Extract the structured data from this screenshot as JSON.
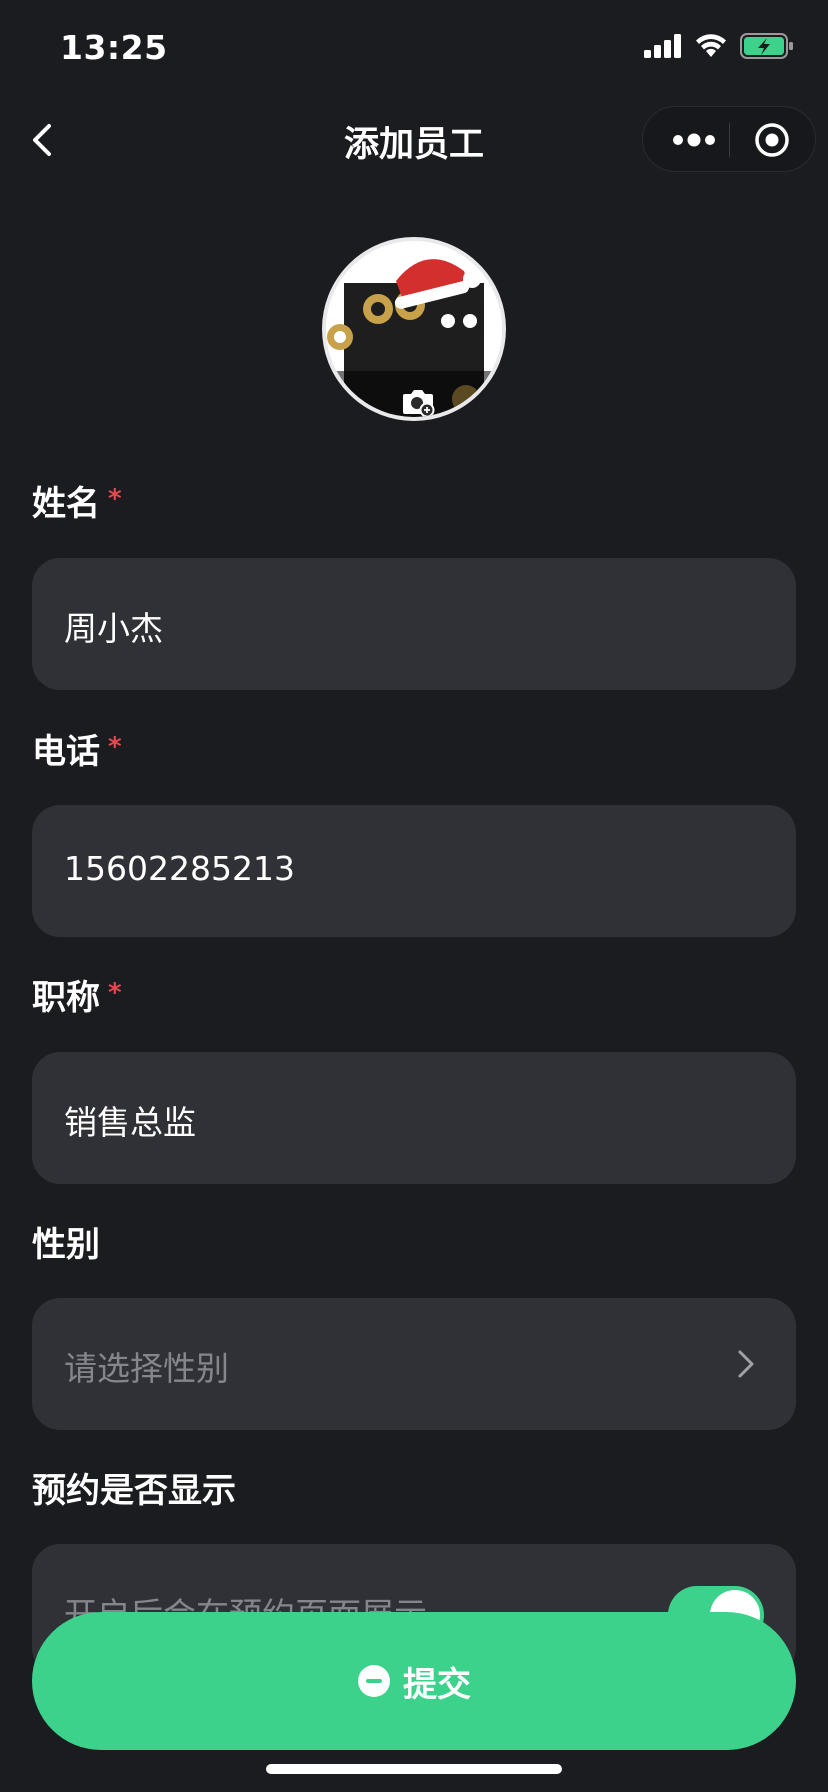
{
  "status_bar": {
    "time": "13:25"
  },
  "nav": {
    "title": "添加员工"
  },
  "form": {
    "name": {
      "label": "姓名",
      "required_mark": "*",
      "value": "周小杰"
    },
    "phone": {
      "label": "电话",
      "required_mark": "*",
      "value": "15602285213"
    },
    "title": {
      "label": "职称",
      "required_mark": "*",
      "value": "销售总监"
    },
    "gender": {
      "label": "性别",
      "placeholder": "请选择性别"
    },
    "booking_display": {
      "label": "预约是否显示",
      "hint": "开启后会在预约页面展示",
      "enabled": true
    }
  },
  "submit": {
    "label": "提交"
  },
  "colors": {
    "accent": "#3dd28c",
    "background": "#1b1c20",
    "field": "#303136",
    "required": "#e5484d"
  }
}
